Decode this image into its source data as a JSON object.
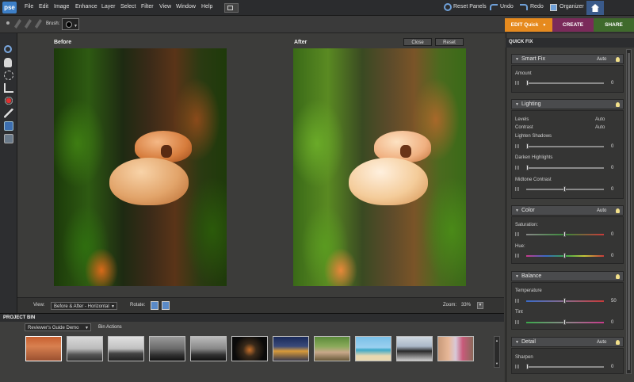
{
  "app": {
    "logo": "pse"
  },
  "menu": [
    "File",
    "Edit",
    "Image",
    "Enhance",
    "Layer",
    "Select",
    "Filter",
    "View",
    "Window",
    "Help"
  ],
  "topright": {
    "reset_panels": "Reset Panels",
    "undo": "Undo",
    "redo": "Redo",
    "organizer": "Organizer"
  },
  "options": {
    "brush_label": "Brush:"
  },
  "modes": {
    "edit": "EDIT Quick",
    "create": "CREATE",
    "share": "SHARE"
  },
  "workspace": {
    "before": "Before",
    "after": "After",
    "close": "Close",
    "reset": "Reset"
  },
  "viewbar": {
    "view_label": "View:",
    "view_value": "Before & After - Horizontal",
    "rotate_label": "Rotate:",
    "zoom_label": "Zoom:",
    "zoom_value": "33%"
  },
  "bin": {
    "title": "PROJECT BIN",
    "album": "Reviewer's Guide Demo",
    "actions": "Bin Actions"
  },
  "panel": {
    "title": "QUICK FIX",
    "smartfix": {
      "title": "Smart Fix",
      "auto": "Auto",
      "amount_label": "Amount",
      "amount": "0"
    },
    "lighting": {
      "title": "Lighting",
      "levels": "Levels",
      "levels_auto": "Auto",
      "contrast": "Contrast",
      "contrast_auto": "Auto",
      "shadows": "Lighten Shadows",
      "shadows_val": "0",
      "highlights": "Darken Highlights",
      "highlights_val": "0",
      "midtone": "Midtone Contrast",
      "midtone_val": "0"
    },
    "color": {
      "title": "Color",
      "auto": "Auto",
      "saturation": "Saturation:",
      "saturation_val": "0",
      "hue": "Hue:",
      "hue_val": "0"
    },
    "balance": {
      "title": "Balance",
      "temperature": "Temperature",
      "temperature_val": "50",
      "tint": "Tint",
      "tint_val": "0"
    },
    "detail": {
      "title": "Detail",
      "auto": "Auto",
      "sharpen": "Sharpen",
      "sharpen_val": "0"
    }
  },
  "colors": {
    "accent_edit": "#e68a1e",
    "create": "#7a2a5a",
    "share": "#3f6a2c"
  }
}
